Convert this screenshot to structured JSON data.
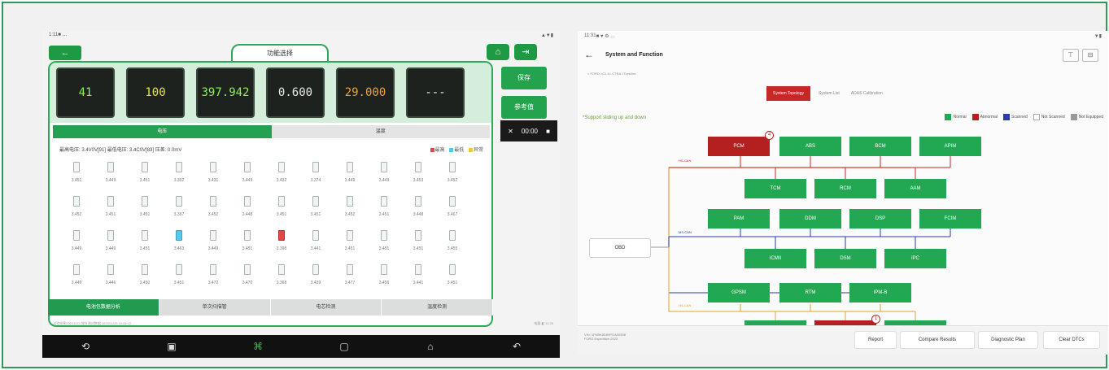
{
  "left": {
    "status": {
      "time": "1:11",
      "icons": "■ …",
      "right": "▲▼▮"
    },
    "title": "功能选择",
    "back_glyph": "←",
    "home_glyph": "⌂",
    "exit_glyph": "⇥",
    "gauges": [
      {
        "value": "41",
        "color": "green"
      },
      {
        "value": "100",
        "color": "yellow"
      },
      {
        "value": "397.942",
        "color": "green"
      },
      {
        "value": "0.600",
        "color": "white"
      },
      {
        "value": "29.000",
        "color": "orange"
      },
      {
        "value": "---",
        "color": "white"
      }
    ],
    "segments": [
      "电压",
      "温度"
    ],
    "info": "最高电压: 3.4V0V[91]   最低电压: 3.4C0V[83]   压差: 0.0mV",
    "legend": [
      "最高",
      "最低",
      "异常"
    ],
    "cells": [
      "3.451",
      "3.449",
      "3.451",
      "3.392",
      "3.431",
      "3.449",
      "3.432",
      "3.374",
      "3.449",
      "3.449",
      "3.453",
      "3.452",
      "3.452",
      "3.451",
      "3.451",
      "3.397",
      "3.452",
      "3.448",
      "3.451",
      "3.451",
      "3.452",
      "3.451",
      "3.448",
      "3.467",
      "3.449",
      "3.449",
      "3.451",
      "3.463",
      "3.449",
      "3.451",
      "3.398",
      "3.441",
      "3.451",
      "3.451",
      "3.451",
      "3.455",
      "3.449",
      "3.446",
      "3.450",
      "3.451",
      "3.472",
      "3.470",
      "3.368",
      "3.439",
      "3.477",
      "3.456",
      "3.441",
      "3.451"
    ],
    "cyan_cell": 27,
    "red_cell": 30,
    "bottom_tabs": [
      "电池包数据分析",
      "单次扫描管",
      "电芯检测",
      "温度检测"
    ],
    "footer": "— 试验结果20231123 保存测试数据 2023/11/26 10:08:12 ...",
    "footer_right": "电量 ◧ 11:26",
    "right_buttons": [
      "保存",
      "参考值"
    ],
    "timer": {
      "text": "00:00"
    },
    "nav": [
      "⟲",
      "▣",
      "⌘",
      "▢",
      "⌂",
      "↶"
    ]
  },
  "right": {
    "status": {
      "time": "11:31",
      "icons": "■ ♥ ⚙ …",
      "right": "▼▮"
    },
    "back_glyph": "←",
    "title": "System and Function",
    "crumb": "< FORD >C1.4>-CTRA >Topshire",
    "tabs": [
      "System Topology",
      "System List",
      "ADAS Calibration"
    ],
    "note": "*Support sliding up and down",
    "legend": [
      {
        "label": "Normal",
        "color": "#22a852"
      },
      {
        "label": "Abnormal",
        "color": "#b42020"
      },
      {
        "label": "Scanned",
        "color": "#2b3da8"
      },
      {
        "label": "Not Scanned",
        "color": "#ffffff"
      },
      {
        "label": "Not Equipped",
        "color": "#9a9a9a"
      }
    ],
    "bus_labels": [
      "HS-CAN",
      "MS-CAN",
      "HS-CAN"
    ],
    "obd": "OBD",
    "modules": [
      {
        "label": "PCM",
        "status": "abnormal",
        "badge": "4"
      },
      {
        "label": "ABS",
        "status": "normal"
      },
      {
        "label": "BCM",
        "status": "normal"
      },
      {
        "label": "APIM",
        "status": "normal"
      },
      {
        "label": "TCM",
        "status": "normal"
      },
      {
        "label": "RCM",
        "status": "normal"
      },
      {
        "label": "AAM",
        "status": "normal"
      },
      {
        "label": "PAM",
        "status": "normal"
      },
      {
        "label": "DDM",
        "status": "normal"
      },
      {
        "label": "DSP",
        "status": "normal"
      },
      {
        "label": "FCIM",
        "status": "normal"
      },
      {
        "label": "ICMII",
        "status": "normal"
      },
      {
        "label": "DSM",
        "status": "normal"
      },
      {
        "label": "IPC",
        "status": "normal"
      },
      {
        "label": "GPSM",
        "status": "normal"
      },
      {
        "label": "RTM",
        "status": "normal"
      },
      {
        "label": "IPM-B",
        "status": "normal"
      },
      {
        "label": "",
        "status": "normal"
      },
      {
        "label": "",
        "status": "abnormal",
        "badge": "1"
      },
      {
        "label": "",
        "status": "normal"
      }
    ],
    "vin": "VIN: 1FM5K8D89PGA00558",
    "vehicle": "FORD Expedition 2023",
    "footer_buttons": [
      "Report",
      "Compare Results",
      "Diagnostic Plan",
      "Clear DTCs"
    ],
    "head_icons": [
      "⊤",
      "⊟"
    ]
  }
}
